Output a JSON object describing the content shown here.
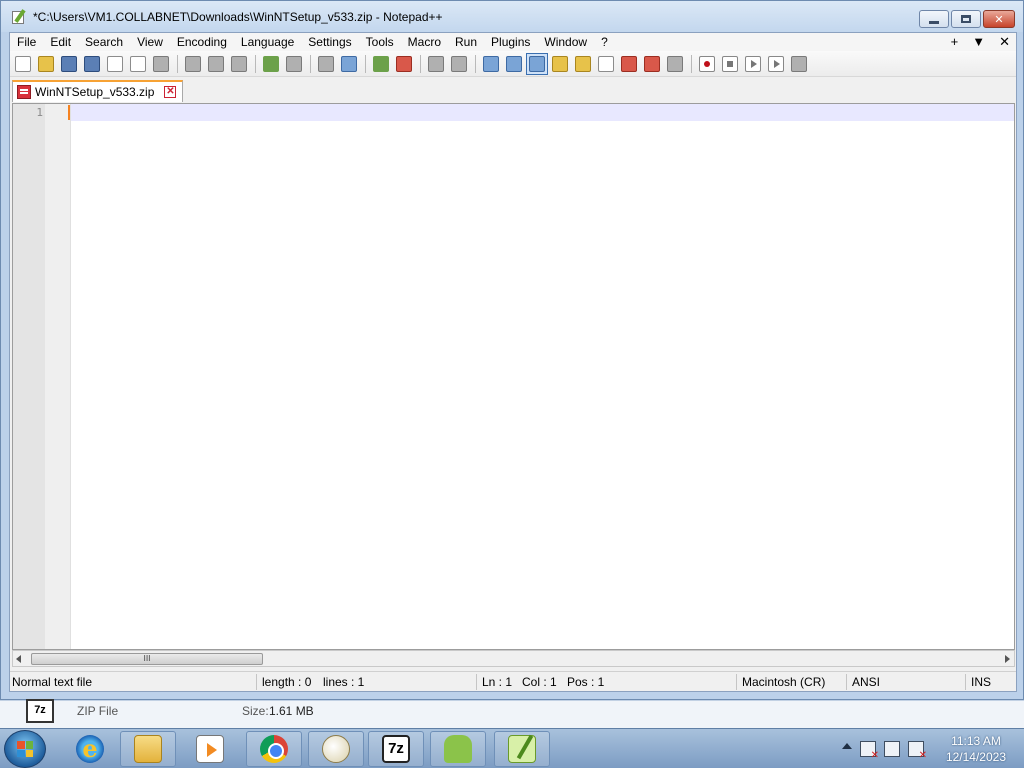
{
  "window": {
    "title": "*C:\\Users\\VM1.COLLABNET\\Downloads\\WinNTSetup_v533.zip - Notepad++",
    "controls": {
      "close": "✕"
    }
  },
  "menu": {
    "items": [
      "File",
      "Edit",
      "Search",
      "View",
      "Encoding",
      "Language",
      "Settings",
      "Tools",
      "Macro",
      "Run",
      "Plugins",
      "Window",
      "?"
    ],
    "right": [
      "+",
      "▼",
      "✕"
    ]
  },
  "toolbar": {
    "icons": [
      "new-file-icon",
      "open-file-icon",
      "save-icon",
      "save-all-icon",
      "close-icon",
      "close-all-icon",
      "print-icon",
      "cut-icon",
      "copy-icon",
      "paste-icon",
      "undo-icon",
      "redo-icon",
      "find-icon",
      "replace-icon",
      "zoom-in-icon",
      "zoom-out-icon",
      "sync-vertical-icon",
      "sync-horizontal-icon",
      "word-wrap-icon",
      "show-all-chars-icon",
      "indent-guide-icon",
      "user-language-icon",
      "doc-map-icon",
      "function-list-icon",
      "folder-workspace-icon",
      "monitoring-icon",
      "record-macro-icon",
      "stop-recording-icon",
      "play-macro-icon",
      "run-macro-multiple-icon",
      "save-macro-icon"
    ]
  },
  "tab": {
    "label": "WinNTSetup_v533.zip",
    "close": "✕"
  },
  "editor": {
    "line_number": "1",
    "content": ""
  },
  "scrollbar": {
    "thumb_grip": "III"
  },
  "statusbar": {
    "file_type": "Normal text file",
    "length": "length : 0",
    "lines": "lines : 1",
    "ln": "Ln : 1",
    "col": "Col : 1",
    "pos": "Pos : 1",
    "eol": "Macintosh (CR)",
    "encoding": "ANSI",
    "mode": "INS"
  },
  "details_pane": {
    "icon_text": "7z",
    "file_type": "ZIP File",
    "size_label": "Size:",
    "size_value": "1.61 MB"
  },
  "taskbar": {
    "apps": [
      "internet-explorer",
      "windows-explorer",
      "media-player",
      "google-chrome",
      "paint",
      "7-zip",
      "android",
      "notepad-plus-plus"
    ],
    "app_7z_label": "7z",
    "ie_label": "e",
    "clock": {
      "time": "11:13 AM",
      "date": "12/14/2023"
    }
  }
}
